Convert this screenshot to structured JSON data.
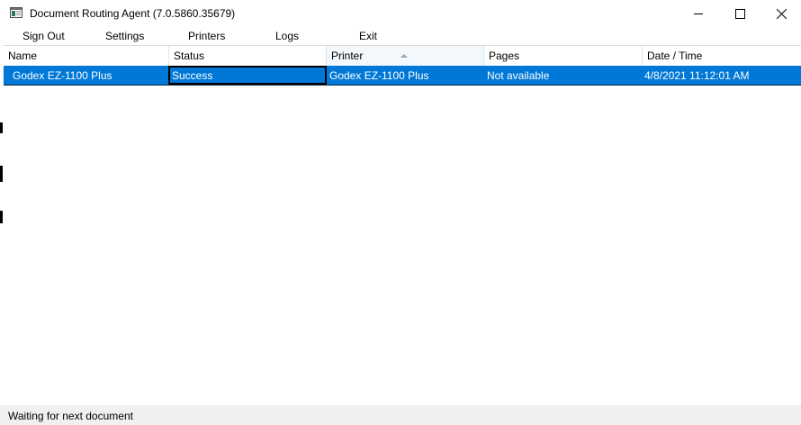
{
  "window": {
    "title": "Document Routing Agent (7.0.5860.35679)",
    "icon": "app-window-icon",
    "controls": {
      "minimize_icon": "minimize-icon",
      "maximize_icon": "maximize-icon",
      "close_icon": "close-icon"
    }
  },
  "menu": {
    "items": [
      {
        "label": "Sign Out"
      },
      {
        "label": "Settings"
      },
      {
        "label": "Printers"
      },
      {
        "label": "Logs"
      },
      {
        "label": "Exit"
      }
    ]
  },
  "grid": {
    "columns": [
      {
        "label": "Name"
      },
      {
        "label": "Status"
      },
      {
        "label": "Printer",
        "sorted": "ascending"
      },
      {
        "label": "Pages"
      },
      {
        "label": "Date / Time"
      }
    ],
    "rows": [
      {
        "selected": true,
        "cells": [
          "Godex EZ-1100 Plus",
          "Success",
          "Godex EZ-1100 Plus",
          "Not available",
          "4/8/2021 11:12:01 AM"
        ]
      }
    ]
  },
  "status": {
    "text": "Waiting for next document"
  },
  "colors": {
    "selection": "#0078d7",
    "statusbar": "#f0f0f0"
  }
}
